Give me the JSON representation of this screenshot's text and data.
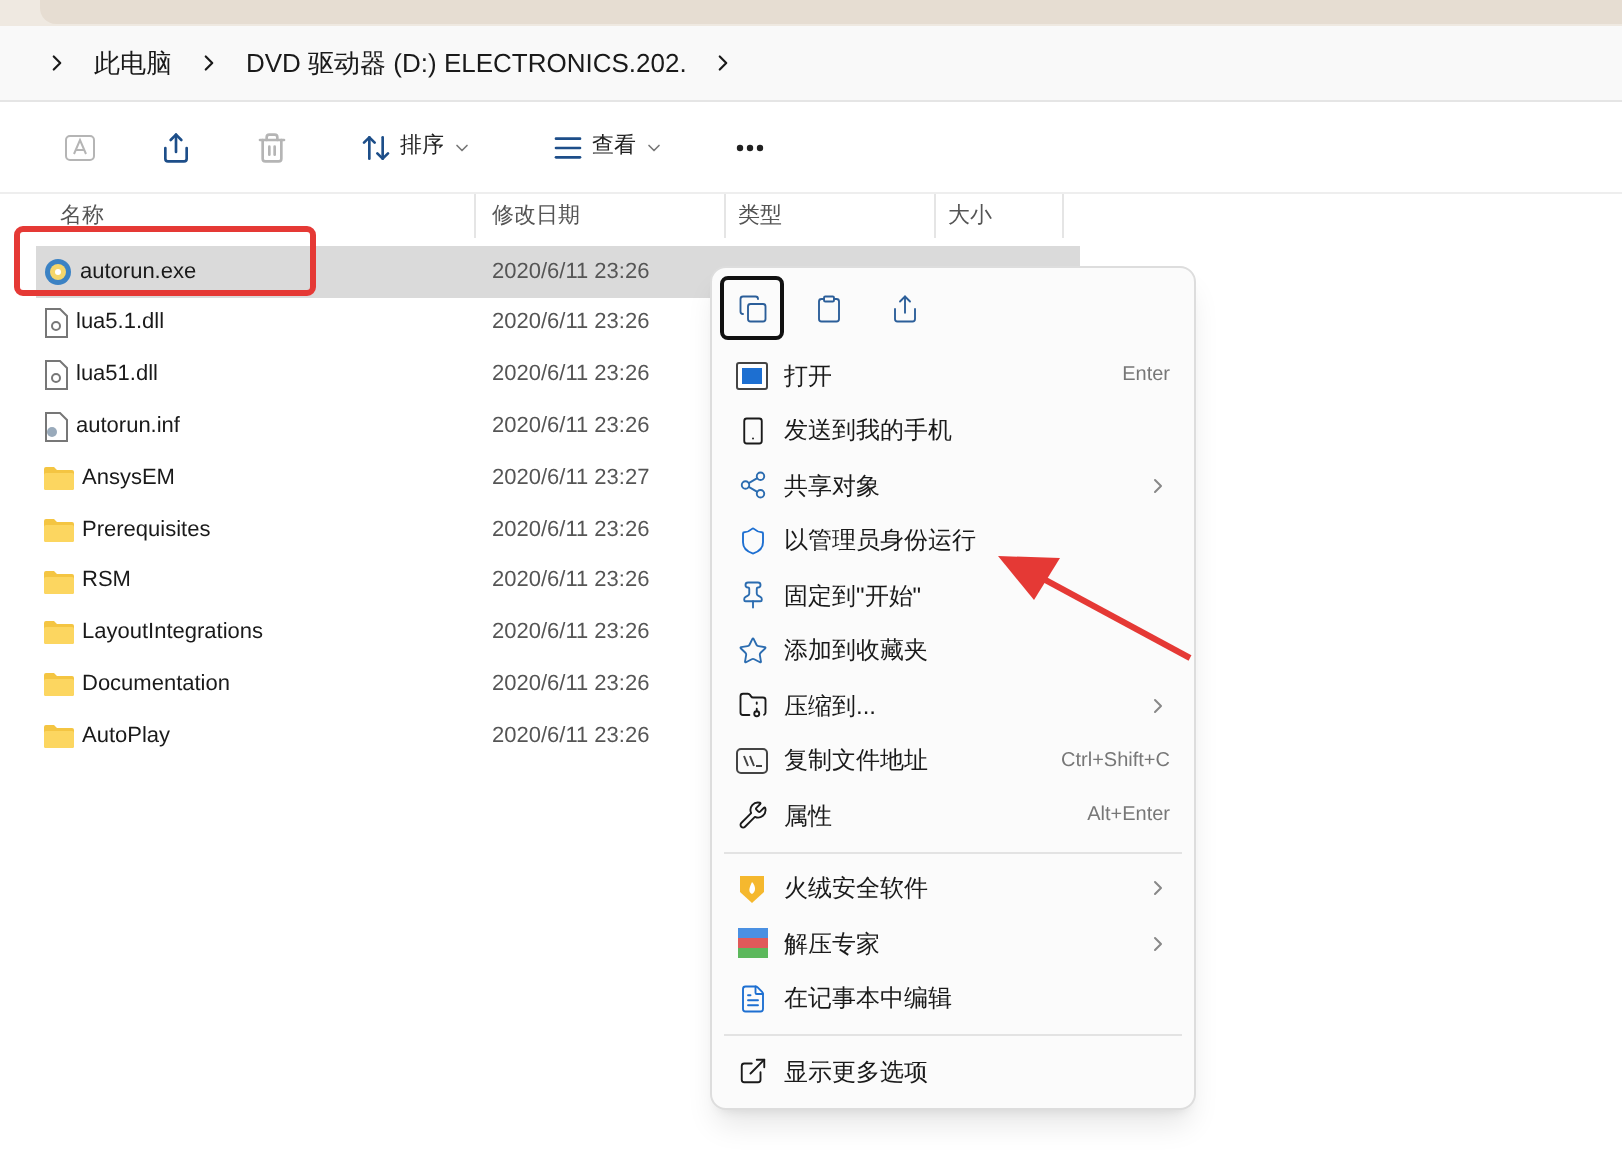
{
  "breadcrumb": [
    {
      "label": "此电脑"
    },
    {
      "label": "DVD 驱动器 (D:) ELECTRONICS.202."
    }
  ],
  "toolbar": {
    "buttons": [
      {
        "kind": "rename",
        "disabled": true
      },
      {
        "kind": "share",
        "disabled": false
      },
      {
        "kind": "delete",
        "disabled": true
      },
      {
        "kind": "sort",
        "label": "排序",
        "disabled": false
      },
      {
        "kind": "view",
        "label": "查看",
        "disabled": false
      },
      {
        "kind": "more",
        "disabled": false
      }
    ]
  },
  "table": {
    "columns": [
      "名称",
      "修改日期",
      "类型",
      "大小"
    ],
    "rows": [
      {
        "name": "autorun.exe",
        "kind": "exe",
        "date": "2020/6/11 23:26",
        "selected": true
      },
      {
        "name": "lua5.1.dll",
        "kind": "dll",
        "date": "2020/6/11 23:26",
        "selected": false
      },
      {
        "name": "lua51.dll",
        "kind": "dll",
        "date": "2020/6/11 23:26",
        "selected": false
      },
      {
        "name": "autorun.inf",
        "kind": "inf",
        "date": "2020/6/11 23:26",
        "selected": false
      },
      {
        "name": "AnsysEM",
        "kind": "folder",
        "date": "2020/6/11 23:27",
        "selected": false
      },
      {
        "name": "Prerequisites",
        "kind": "folder",
        "date": "2020/6/11 23:26",
        "selected": false
      },
      {
        "name": "RSM",
        "kind": "folder",
        "date": "2020/6/11 23:26",
        "selected": false
      },
      {
        "name": "LayoutIntegrations",
        "kind": "folder",
        "date": "2020/6/11 23:26",
        "selected": false
      },
      {
        "name": "Documentation",
        "kind": "folder",
        "date": "2020/6/11 23:26",
        "selected": false
      },
      {
        "name": "AutoPlay",
        "kind": "folder",
        "date": "2020/6/11 23:26",
        "selected": false
      }
    ]
  },
  "context_menu": {
    "quick_actions": [
      {
        "kind": "copy",
        "selected": true
      },
      {
        "kind": "paste",
        "selected": false
      },
      {
        "kind": "share",
        "selected": false
      }
    ],
    "items": [
      {
        "label": "打开",
        "shortcut": "Enter",
        "submenu": false
      },
      {
        "label": "发送到我的手机",
        "submenu": false
      },
      {
        "label": "共享对象",
        "submenu": true
      },
      {
        "label": "以管理员身份运行",
        "submenu": false
      },
      {
        "label": "固定到\"开始\"",
        "submenu": false
      },
      {
        "label": "添加到收藏夹",
        "submenu": false
      },
      {
        "label": "压缩到...",
        "submenu": true
      },
      {
        "label": "复制文件地址",
        "shortcut": "Ctrl+Shift+C",
        "submenu": false
      },
      {
        "label": "属性",
        "shortcut": "Alt+Enter",
        "submenu": false
      },
      {
        "kind": "divider"
      },
      {
        "label": "火绒安全软件",
        "submenu": true
      },
      {
        "label": "解压专家",
        "submenu": true
      },
      {
        "label": "在记事本中编辑",
        "submenu": false
      },
      {
        "kind": "divider"
      },
      {
        "label": "显示更多选项",
        "submenu": false
      }
    ]
  }
}
